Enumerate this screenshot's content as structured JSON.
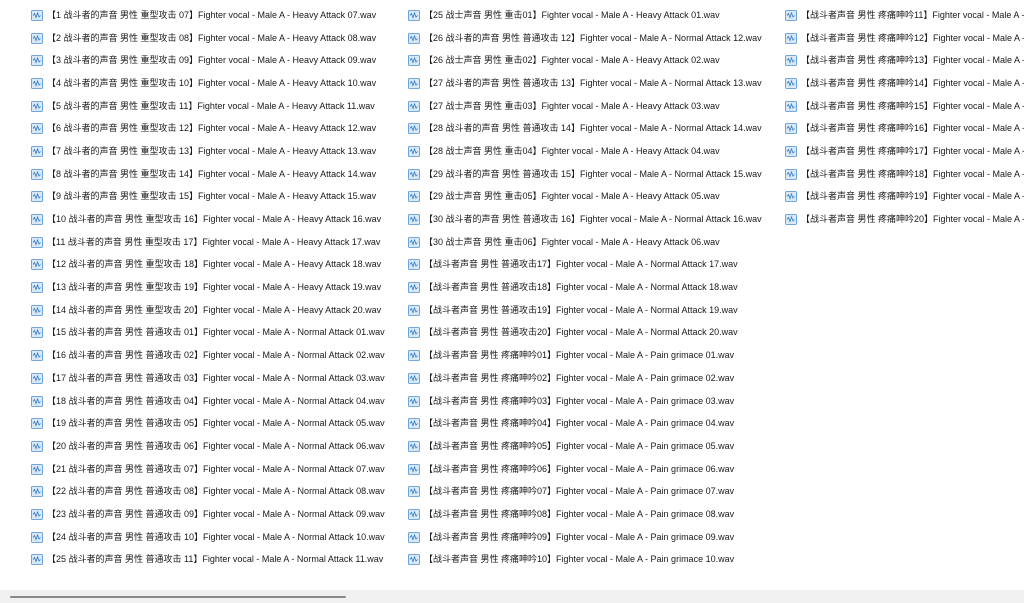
{
  "file_list": {
    "icon": "wav-audio-file-icon",
    "columns": [
      [
        "【1 战斗者的声音 男性 重型攻击 07】Fighter vocal - Male A - Heavy Attack 07.wav",
        "【2 战斗者的声音 男性 重型攻击 08】Fighter vocal - Male A - Heavy Attack 08.wav",
        "【3 战斗者的声音 男性 重型攻击 09】Fighter vocal - Male A - Heavy Attack 09.wav",
        "【4 战斗者的声音 男性 重型攻击 10】Fighter vocal - Male A - Heavy Attack 10.wav",
        "【5 战斗者的声音 男性 重型攻击 11】Fighter vocal - Male A - Heavy Attack 11.wav",
        "【6 战斗者的声音 男性 重型攻击 12】Fighter vocal - Male A - Heavy Attack 12.wav",
        "【7 战斗者的声音 男性 重型攻击 13】Fighter vocal - Male A - Heavy Attack 13.wav",
        "【8 战斗者的声音 男性 重型攻击 14】Fighter vocal - Male A - Heavy Attack 14.wav",
        "【9 战斗者的声音 男性 重型攻击 15】Fighter vocal - Male A - Heavy Attack 15.wav",
        "【10 战斗者的声音 男性 重型攻击 16】Fighter vocal - Male A - Heavy Attack 16.wav",
        "【11 战斗者的声音 男性 重型攻击 17】Fighter vocal - Male A - Heavy Attack 17.wav",
        "【12 战斗者的声音 男性 重型攻击 18】Fighter vocal - Male A - Heavy Attack 18.wav",
        "【13 战斗者的声音 男性 重型攻击 19】Fighter vocal - Male A - Heavy Attack 19.wav",
        "【14 战斗者的声音 男性 重型攻击 20】Fighter vocal - Male A - Heavy Attack 20.wav",
        "【15 战斗者的声音 男性 普通攻击 01】Fighter vocal - Male A - Normal Attack 01.wav",
        "【16 战斗者的声音 男性 普通攻击 02】Fighter vocal - Male A - Normal Attack 02.wav",
        "【17 战斗者的声音 男性 普通攻击 03】Fighter vocal - Male A - Normal Attack 03.wav",
        "【18 战斗者的声音 男性 普通攻击 04】Fighter vocal - Male A - Normal Attack 04.wav",
        "【19 战斗者的声音 男性 普通攻击 05】Fighter vocal - Male A - Normal Attack 05.wav",
        "【20 战斗者的声音 男性 普通攻击 06】Fighter vocal - Male A - Normal Attack 06.wav",
        "【21 战斗者的声音 男性 普通攻击 07】Fighter vocal - Male A - Normal Attack 07.wav",
        "【22 战斗者的声音 男性 普通攻击 08】Fighter vocal - Male A - Normal Attack 08.wav",
        "【23 战斗者的声音 男性 普通攻击 09】Fighter vocal - Male A - Normal Attack 09.wav",
        "【24 战斗者的声音 男性 普通攻击 10】Fighter vocal - Male A - Normal Attack 10.wav",
        "【25 战斗者的声音 男性 普通攻击 11】Fighter vocal - Male A - Normal Attack 11.wav"
      ],
      [
        "【25 战士声音 男性 重击01】Fighter vocal - Male A - Heavy Attack 01.wav",
        "【26 战斗者的声音 男性 普通攻击 12】Fighter vocal - Male A - Normal Attack 12.wav",
        "【26 战士声音 男性 重击02】Fighter vocal - Male A - Heavy Attack 02.wav",
        "【27 战斗者的声音 男性 普通攻击 13】Fighter vocal - Male A - Normal Attack 13.wav",
        "【27 战士声音 男性 重击03】Fighter vocal - Male A - Heavy Attack 03.wav",
        "【28 战斗者的声音 男性 普通攻击 14】Fighter vocal - Male A - Normal Attack 14.wav",
        "【28 战士声音 男性 重击04】Fighter vocal - Male A - Heavy Attack 04.wav",
        "【29 战斗者的声音 男性 普通攻击 15】Fighter vocal - Male A - Normal Attack 15.wav",
        "【29 战士声音 男性 重击05】Fighter vocal - Male A - Heavy Attack 05.wav",
        "【30 战斗者的声音 男性 普通攻击 16】Fighter vocal - Male A - Normal Attack 16.wav",
        "【30 战士声音 男性 重击06】Fighter vocal - Male A - Heavy Attack 06.wav",
        "【战斗者声音 男性 普通攻击17】Fighter vocal - Male A - Normal Attack 17.wav",
        "【战斗者声音 男性 普通攻击18】Fighter vocal - Male A - Normal Attack 18.wav",
        "【战斗者声音 男性 普通攻击19】Fighter vocal - Male A - Normal Attack 19.wav",
        "【战斗者声音 男性 普通攻击20】Fighter vocal - Male A - Normal Attack 20.wav",
        "【战斗者声音 男性 疼痛呻吟01】Fighter vocal - Male A - Pain grimace 01.wav",
        "【战斗者声音 男性 疼痛呻吟02】Fighter vocal - Male A - Pain grimace 02.wav",
        "【战斗者声音 男性 疼痛呻吟03】Fighter vocal - Male A - Pain grimace 03.wav",
        "【战斗者声音 男性 疼痛呻吟04】Fighter vocal - Male A - Pain grimace 04.wav",
        "【战斗者声音 男性 疼痛呻吟05】Fighter vocal - Male A - Pain grimace 05.wav",
        "【战斗者声音 男性 疼痛呻吟06】Fighter vocal - Male A - Pain grimace 06.wav",
        "【战斗者声音 男性 疼痛呻吟07】Fighter vocal - Male A - Pain grimace 07.wav",
        "【战斗者声音 男性 疼痛呻吟08】Fighter vocal - Male A - Pain grimace 08.wav",
        "【战斗者声音 男性 疼痛呻吟09】Fighter vocal - Male A - Pain grimace 09.wav",
        "【战斗者声音 男性 疼痛呻吟10】Fighter vocal - Male A - Pain grimace 10.wav"
      ],
      [
        "【战斗者声音 男性 疼痛呻吟11】Fighter vocal - Male A - P",
        "【战斗者声音 男性 疼痛呻吟12】Fighter vocal - Male A - P",
        "【战斗者声音 男性 疼痛呻吟13】Fighter vocal - Male A - P",
        "【战斗者声音 男性 疼痛呻吟14】Fighter vocal - Male A - P",
        "【战斗者声音 男性 疼痛呻吟15】Fighter vocal - Male A - P",
        "【战斗者声音 男性 疼痛呻吟16】Fighter vocal - Male A - P",
        "【战斗者声音 男性 疼痛呻吟17】Fighter vocal - Male A - P",
        "【战斗者声音 男性 疼痛呻吟18】Fighter vocal - Male A - P",
        "【战斗者声音 男性 疼痛呻吟19】Fighter vocal - Male A - P",
        "【战斗者声音 男性 疼痛呻吟20】Fighter vocal - Male A - P"
      ]
    ]
  },
  "colors": {
    "background": "#ffffff",
    "text": "#1a1a1a",
    "icon_body": "#dbe9f7",
    "icon_border": "#4a90d6",
    "icon_accent": "#2f7bc8",
    "scrollbar_track": "#f0f0f0",
    "scrollbar_thumb": "#8a8a8a"
  }
}
